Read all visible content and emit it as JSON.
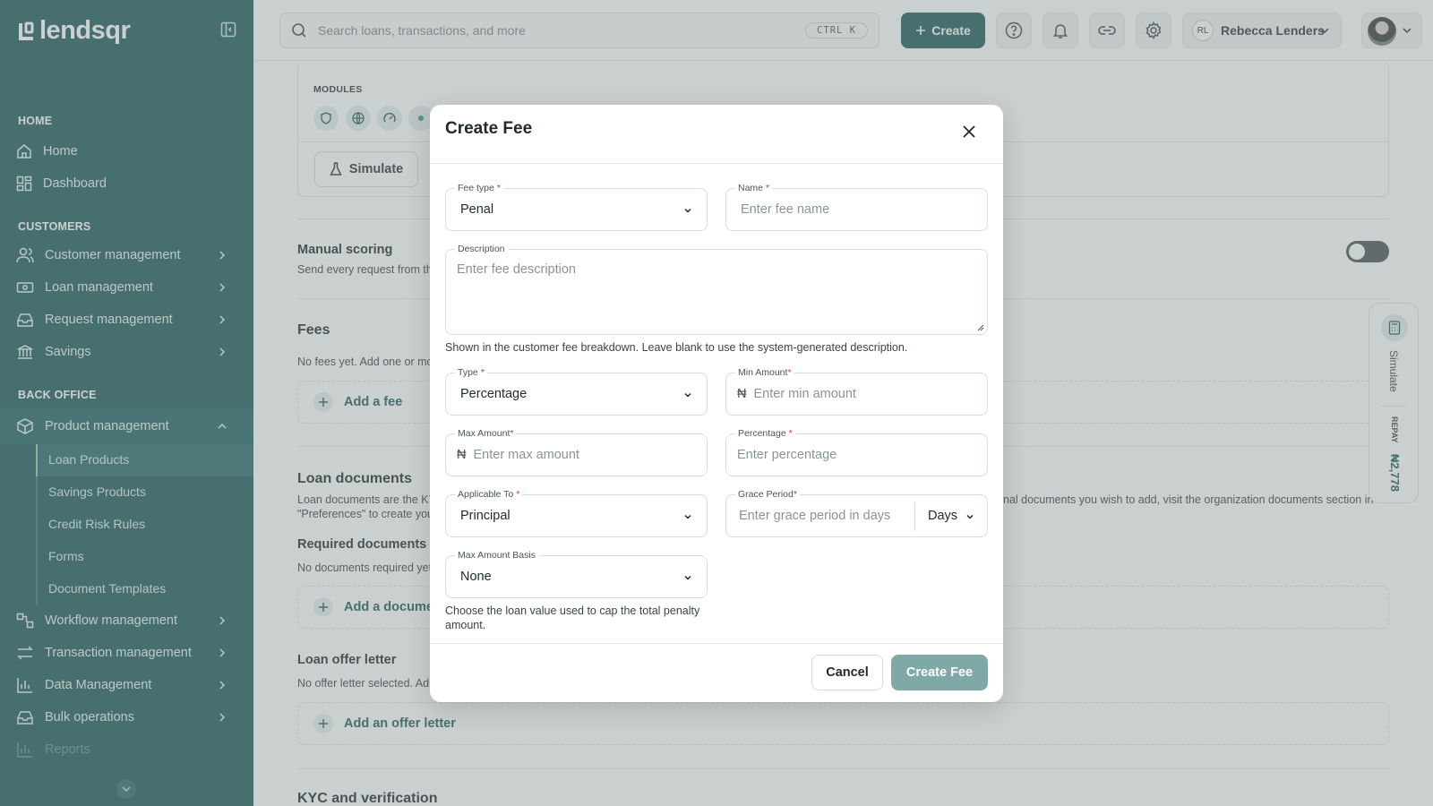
{
  "app": {
    "name": "lendsqr"
  },
  "sidebar": {
    "sections": {
      "home": "HOME",
      "customers": "CUSTOMERS",
      "back_office": "BACK OFFICE"
    },
    "items": {
      "home": "Home",
      "dashboard": "Dashboard",
      "customer_management": "Customer management",
      "loan_management": "Loan management",
      "request_management": "Request management",
      "savings": "Savings",
      "product_management": "Product management",
      "workflow_management": "Workflow management",
      "transaction_management": "Transaction management",
      "data_management": "Data Management",
      "bulk_operations": "Bulk operations",
      "reports": "Reports"
    },
    "product_sub": [
      "Loan Products",
      "Savings Products",
      "Credit Risk Rules",
      "Forms",
      "Document Templates"
    ]
  },
  "topbar": {
    "search_placeholder": "Search loans, transactions, and more",
    "shortcut": "CTRL  K",
    "create_label": "Create",
    "user_initials": "RL",
    "user_name": "Rebecca Lenders"
  },
  "page": {
    "modules_label": "MODULES",
    "simulate_label": "Simulate",
    "manual_scoring_title": "Manual scoring",
    "manual_scoring_desc": "Send every request from th",
    "fees_title": "Fees",
    "fees_empty": "No fees yet. Add one or mo",
    "add_fee": "Add a fee",
    "loan_docs_title": "Loan documents",
    "loan_docs_desc_left": "Loan documents are the KY",
    "loan_docs_desc_left2": "\"Preferences\" to create you",
    "loan_docs_desc_right": "nal documents you wish to add, visit the organization documents section in",
    "required_docs_title": "Required documents",
    "required_docs_desc": "No documents required yet",
    "add_document": "Add a docume",
    "offer_letter_title": "Loan offer letter",
    "offer_letter_desc": "No offer letter selected. Ad",
    "add_offer_letter": "Add an offer letter",
    "kyc_title": "KYC and verification"
  },
  "right_panel": {
    "simulate": "Simulate",
    "repay_label": "REPAY",
    "repay_value": "₦2,778"
  },
  "modal": {
    "title": "Create Fee",
    "fee_type": {
      "label": "Fee type",
      "value": "Penal"
    },
    "name": {
      "label": "Name",
      "placeholder": "Enter fee name"
    },
    "description": {
      "label": "Description",
      "placeholder": "Enter fee description",
      "hint": "Shown in the customer fee breakdown. Leave blank to use the system-generated description."
    },
    "type": {
      "label": "Type",
      "value": "Percentage"
    },
    "min_amount": {
      "label": "Min Amount",
      "currency": "₦",
      "placeholder": "Enter min amount"
    },
    "max_amount": {
      "label": "Max Amount",
      "currency": "₦",
      "placeholder": "Enter max amount"
    },
    "percentage": {
      "label": "Percentage",
      "placeholder": "Enter percentage"
    },
    "applicable_to": {
      "label": "Applicable To",
      "value": "Principal"
    },
    "grace_period": {
      "label": "Grace Period",
      "placeholder": "Enter grace period in days",
      "unit": "Days"
    },
    "max_amount_basis": {
      "label": "Max Amount Basis",
      "value": "None",
      "hint": "Choose the loan value used to cap the total penalty amount."
    },
    "cancel_label": "Cancel",
    "submit_label": "Create Fee"
  },
  "colors": {
    "brand": "#1e5a5c",
    "sidebar_active": "#2a6a6c",
    "submit_disabled": "#7fa9a7",
    "required": "#dd3333"
  }
}
